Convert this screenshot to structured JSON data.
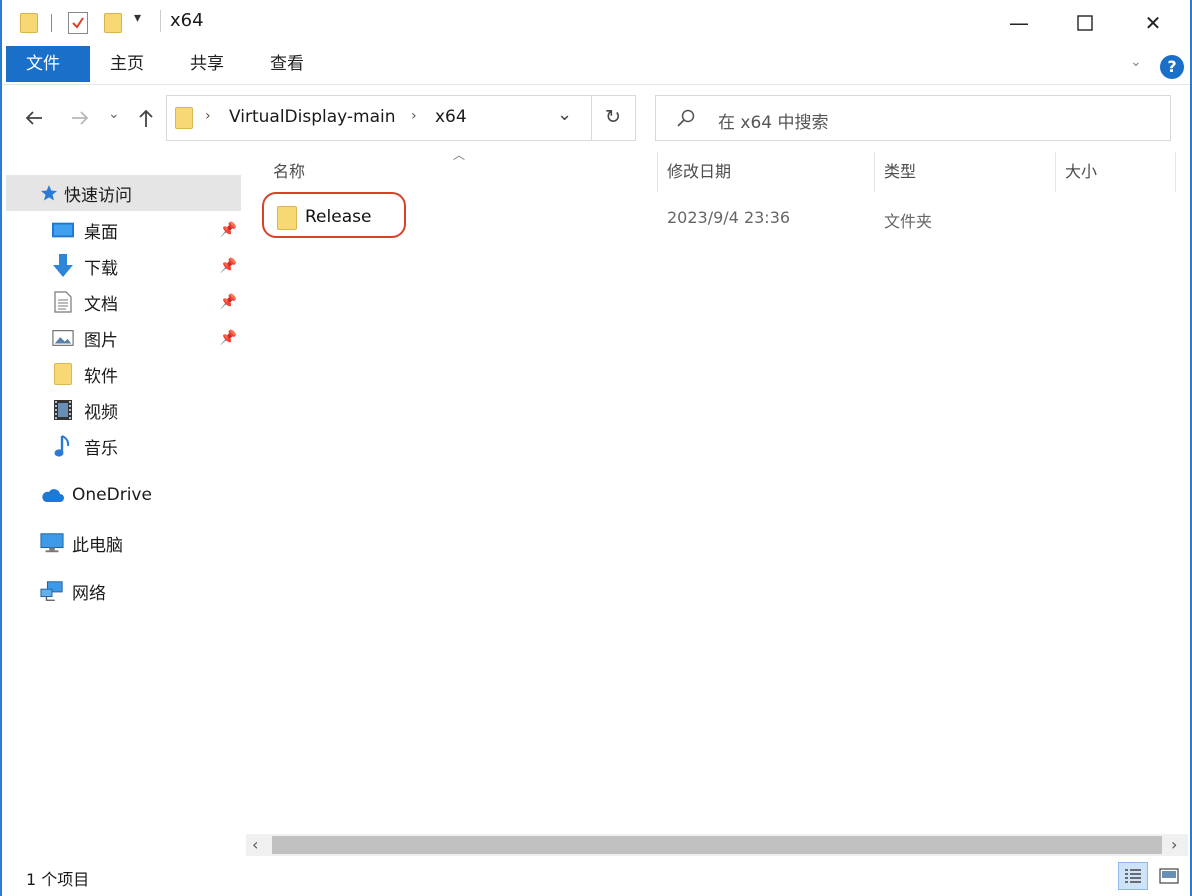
{
  "window": {
    "title": "x64",
    "controls": {
      "minimize": "—",
      "maximize": "☐",
      "close": "✕"
    }
  },
  "ribbon": {
    "tabs": [
      {
        "label": "文件",
        "active": true
      },
      {
        "label": "主页",
        "active": false
      },
      {
        "label": "共享",
        "active": false
      },
      {
        "label": "查看",
        "active": false
      }
    ],
    "help": "?"
  },
  "address": {
    "breadcrumb": [
      "VirtualDisplay-main",
      "x64"
    ]
  },
  "search": {
    "placeholder": "在 x64 中搜索"
  },
  "sidebar": {
    "quick_access": "快速访问",
    "pinned": [
      {
        "label": "桌面",
        "icon": "desktop-icon"
      },
      {
        "label": "下载",
        "icon": "download-icon"
      },
      {
        "label": "文档",
        "icon": "document-icon"
      },
      {
        "label": "图片",
        "icon": "picture-icon"
      }
    ],
    "folders": [
      {
        "label": "软件",
        "icon": "folder-icon"
      },
      {
        "label": "视频",
        "icon": "video-icon"
      },
      {
        "label": "音乐",
        "icon": "music-icon"
      }
    ],
    "onedrive": "OneDrive",
    "this_pc": "此电脑",
    "network": "网络"
  },
  "columns": {
    "name": "名称",
    "modified": "修改日期",
    "type": "类型",
    "size": "大小"
  },
  "files": [
    {
      "name": "Release",
      "modified": "2023/9/4 23:36",
      "type": "文件夹",
      "size": ""
    }
  ],
  "status": {
    "count": "1 个项目"
  },
  "colors": {
    "accent": "#1a6fc9",
    "highlight_ring": "#d9412b",
    "folder": "#f8d775"
  }
}
